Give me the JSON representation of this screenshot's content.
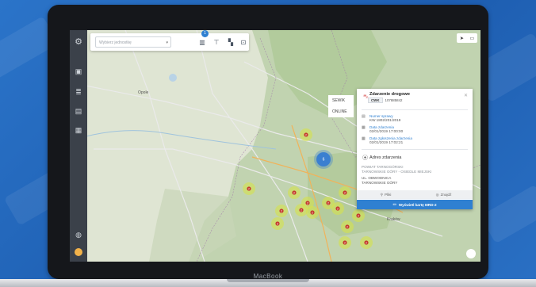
{
  "device": {
    "brand_label": "MacBook"
  },
  "app": {
    "search": {
      "placeholder": "Wybierz jednostkę"
    },
    "filter_badge_count": "1",
    "layers": {
      "items": [
        "SEWIK",
        "ONLINE"
      ]
    },
    "sidebar_icons": [
      "settings-gear-icon",
      "map-icon",
      "layers-icon",
      "document-icon",
      "calendar-icon",
      "globe-icon",
      "user-avatar-icon"
    ],
    "toolbar_icons": [
      "filter-icon",
      "funnel-icon",
      "map-layers-icon",
      "measure-icon"
    ]
  },
  "map": {
    "clusters": [
      {
        "count": "2",
        "color": "#d6e34b"
      },
      {
        "count": "6",
        "color": "#3a7fd0"
      },
      {
        "count": "2",
        "color": "#d6e34b"
      },
      {
        "count": "2",
        "color": "#d6e34b"
      },
      {
        "count": "3",
        "color": "#d6e34b"
      },
      {
        "count": "2",
        "color": "#d6e34b"
      },
      {
        "count": "2",
        "color": "#d6e34b"
      },
      {
        "count": "2",
        "color": "#d6e34b"
      },
      {
        "count": "2",
        "color": "#d6e34b"
      },
      {
        "count": "2",
        "color": "#d6e34b"
      },
      {
        "count": "2",
        "color": "#d6e34b"
      },
      {
        "count": "2",
        "color": "#d6e34b"
      },
      {
        "count": "2",
        "color": "#d6e34b"
      },
      {
        "count": "2",
        "color": "#d6e34b"
      },
      {
        "count": "2",
        "color": "#d6e34b"
      },
      {
        "count": "2",
        "color": "#d6e34b"
      }
    ],
    "city_labels": [
      {
        "text": "Opole"
      },
      {
        "text": "Kraków"
      }
    ]
  },
  "popup": {
    "title": "Zdarzenie drogowe",
    "type_code": "CWK",
    "id": "107885842",
    "fields": [
      {
        "label": "Numer sprawy",
        "value": "KW 1802/201/2019"
      },
      {
        "label": "Data zdarzenia",
        "value": "02/01/2019 17:00:00"
      },
      {
        "label": "Data zgłoszenia zdarzenia",
        "value": "02/01/2019 17:02:21"
      }
    ],
    "address_title": "Adres zdarzenia",
    "address_lines": [
      "POWIAT TARNOGÓRSKI",
      "TARNOWSKIE GÓRY - OSIEDLE MIEJSKI",
      "UL. OBWODNICA",
      "TARNOWSKIE GÓRY"
    ],
    "footer": {
      "files_label": "Pliki",
      "notes_label": "Znajdź"
    },
    "main_button": "Wyświetl kartę MRD-2"
  }
}
